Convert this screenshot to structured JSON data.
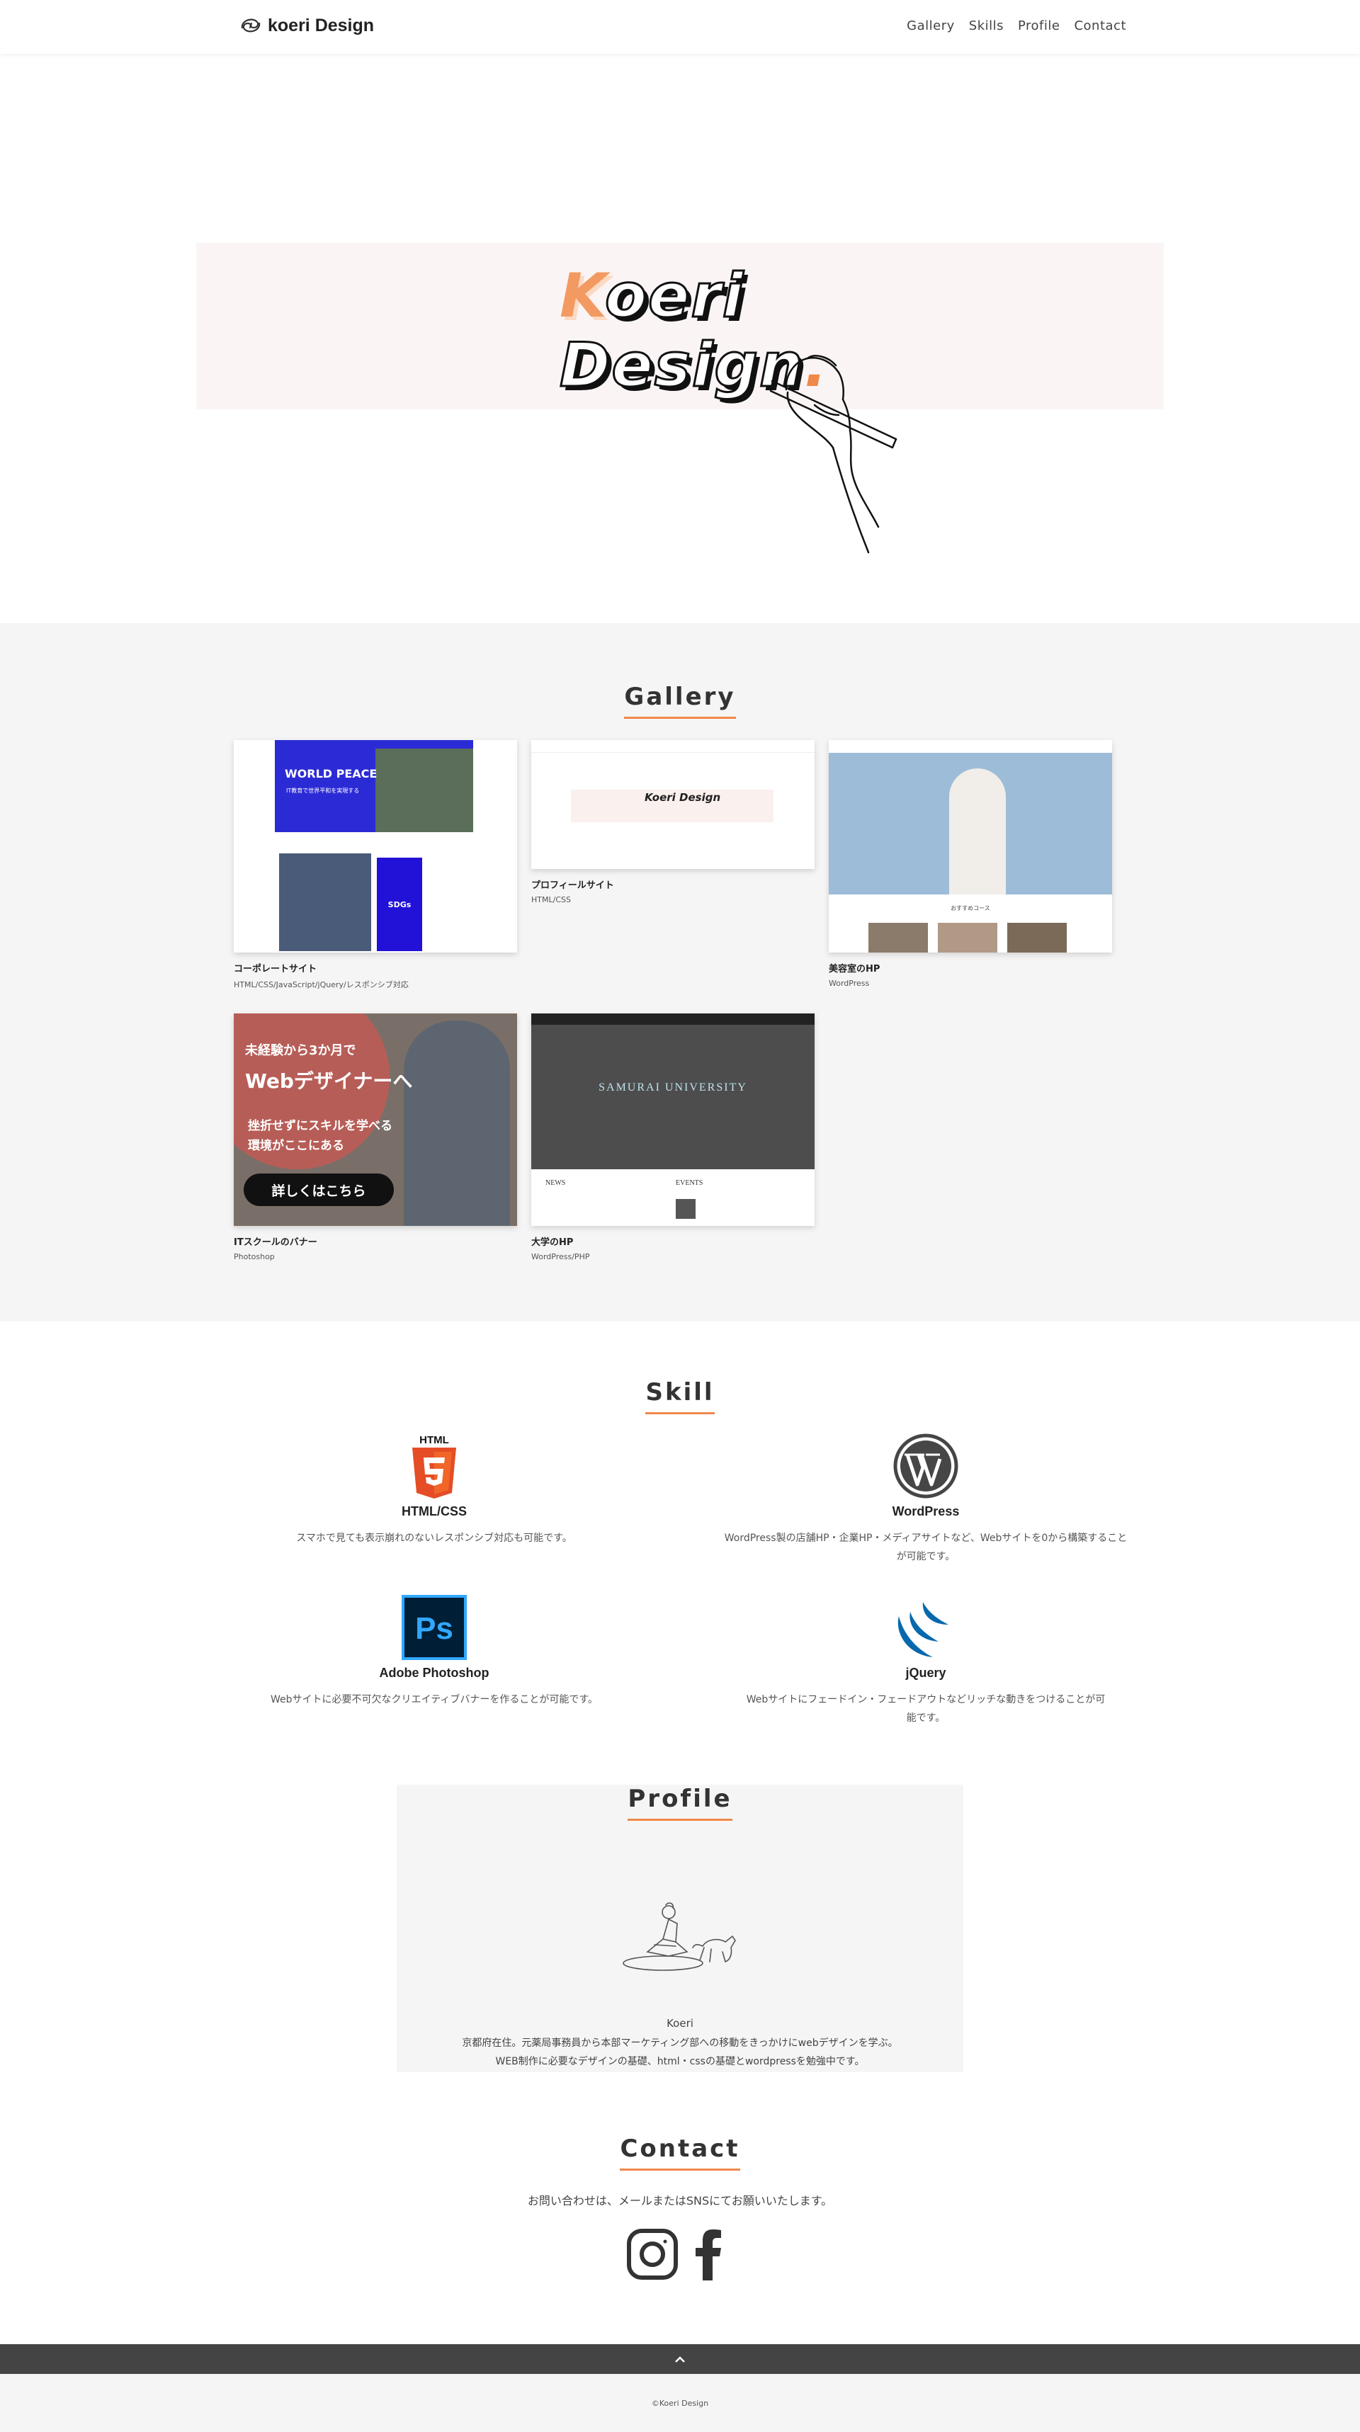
{
  "header": {
    "logo_text": "koeri Design",
    "nav": [
      "Gallery",
      "Skills",
      "Profile",
      "Contact"
    ]
  },
  "hero": {
    "title_line1_initial": "K",
    "title_line1_rest": "oeri",
    "title_line2": "Design",
    "title_dot": "."
  },
  "gallery": {
    "title": "Gallery",
    "items": [
      {
        "name": "コーポレートサイト",
        "tech": "HTML/CSS/JavaScript/jQuery/レスポンシブ対応",
        "thumb_text": "WORLD PEACE",
        "thumb_sub": "IT教育で世界平和を実現する",
        "thumb_badge": "SDGs"
      },
      {
        "name": "プロフィールサイト",
        "tech": "HTML/CSS",
        "thumb_text": "Koeri Design"
      },
      {
        "name": "美容室のHP",
        "tech": "WordPress",
        "thumb_text": "おすすめコース"
      },
      {
        "name": "ITスクールのバナー",
        "tech": "Photoshop",
        "thumb_line1": "未経験から3か月で",
        "thumb_line2": "Webデザイナーへ",
        "thumb_line3": "挫折せずにスキルを学べる",
        "thumb_line4": "環境がここにある",
        "thumb_btn": "詳しくはこちら"
      },
      {
        "name": "大学のHP",
        "tech": "WordPress/PHP",
        "thumb_text": "SAMURAI UNIVERSITY",
        "thumb_news": "NEWS",
        "thumb_events": "EVENTS"
      }
    ]
  },
  "skill": {
    "title": "Skill",
    "items": [
      {
        "name": "HTML/CSS",
        "desc": "スマホで見ても表示崩れのないレスポンシブ対応も可能です。",
        "icon": "html5-icon"
      },
      {
        "name": "WordPress",
        "desc": "WordPress製の店舗HP・企業HP・メディアサイトなど、Webサイトを0から構築することが可能です。",
        "icon": "wordpress-icon"
      },
      {
        "name": "Adobe Photoshop",
        "desc": "Webサイトに必要不可欠なクリエイティブバナーを作ることが可能です。",
        "icon": "photoshop-icon"
      },
      {
        "name": "jQuery",
        "desc": "Webサイトにフェードイン・フェードアウトなどリッチな動きをつけることが可能です。",
        "icon": "jquery-icon"
      }
    ]
  },
  "profile": {
    "title": "Profile",
    "name": "Koeri",
    "line1": "京都府在住。元薬局事務員から本部マーケティング部への移動をきっかけにwebデザインを学ぶ。",
    "line2": "WEB制作に必要なデザインの基礎、html・cssの基礎とwordpressを勉強中です。"
  },
  "contact": {
    "title": "Contact",
    "text": "お問い合わせは、メールまたはSNSにてお願いいたします。"
  },
  "footer": {
    "copyright": "©Koeri Design"
  },
  "colors": {
    "accent": "#f0884a",
    "gallery_bg": "#f6f5f5",
    "hero_band": "#faf5f4",
    "footer_bar": "#444444"
  }
}
